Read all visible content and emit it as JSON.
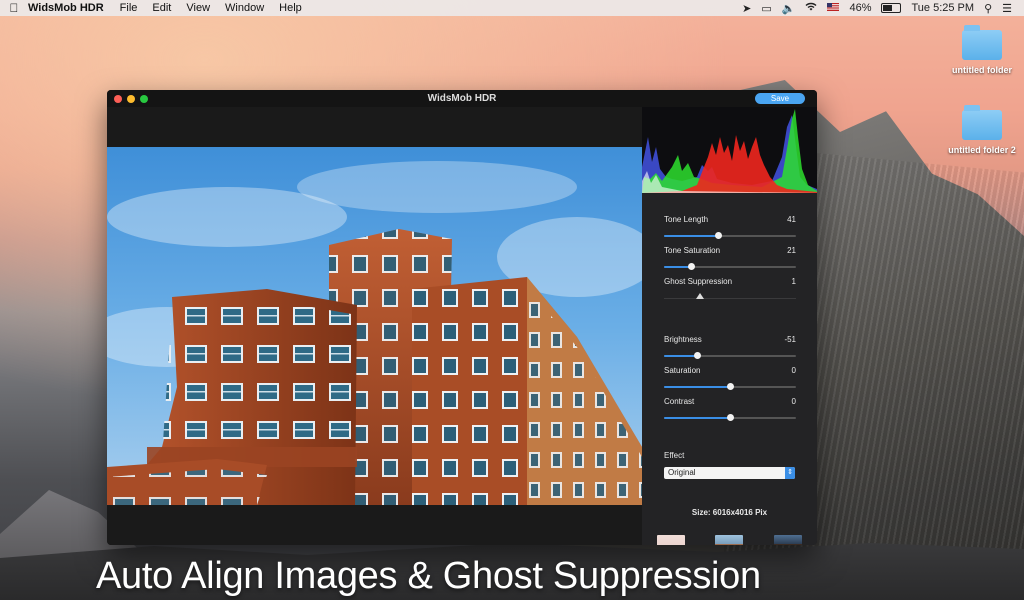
{
  "menubar": {
    "app_name": "WidsMob HDR",
    "items": [
      "File",
      "Edit",
      "View",
      "Window",
      "Help"
    ],
    "battery": "46%",
    "battery_level": 0.46,
    "clock": "Tue 5:25 PM",
    "icons": [
      "apple-icon",
      "location-icon",
      "display-icon",
      "volume-icon",
      "wifi-icon",
      "flag-icon",
      "search-icon",
      "list-icon"
    ]
  },
  "desktop": {
    "folders": [
      {
        "label": "untitled folder"
      },
      {
        "label": "untitled folder 2"
      }
    ]
  },
  "window": {
    "title": "WidsMob HDR",
    "save_label": "Save",
    "panel": {
      "sliders": [
        {
          "label": "Tone Length",
          "value": "41",
          "position": 0.41
        },
        {
          "label": "Tone Saturation",
          "value": "21",
          "position": 0.21
        },
        {
          "label": "Ghost Suppression",
          "value": "1",
          "position": 0.27,
          "style": "ghost"
        },
        {
          "label": "Brightness",
          "value": "-51",
          "position": 0.25
        },
        {
          "label": "Saturation",
          "value": "0",
          "position": 0.5
        },
        {
          "label": "Contrast",
          "value": "0",
          "position": 0.5
        }
      ],
      "effect_label": "Effect",
      "effect_value": "Original",
      "size": "Size: 6016x4016 Pix"
    }
  },
  "caption": "Auto Align Images & Ghost Suppression",
  "colors": {
    "accent": "#3a8ee6",
    "save_button": "#4aa5f2"
  }
}
